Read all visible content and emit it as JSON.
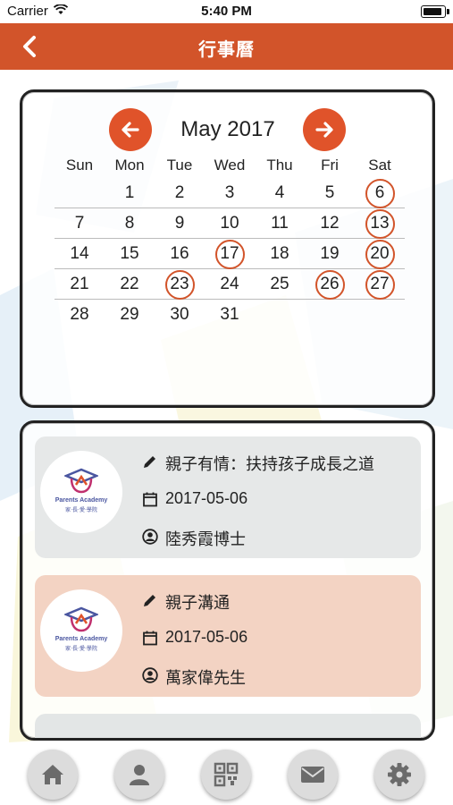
{
  "status_bar": {
    "carrier": "Carrier",
    "time": "5:40 PM"
  },
  "nav": {
    "title": "行事曆",
    "back_icon": "chevron-left-icon"
  },
  "calendar": {
    "month_label": "May 2017",
    "prev_icon": "arrow-left-icon",
    "next_icon": "arrow-right-icon",
    "weekdays": [
      "Sun",
      "Mon",
      "Tue",
      "Wed",
      "Thu",
      "Fri",
      "Sat"
    ],
    "weeks": [
      [
        "",
        "1",
        "2",
        "3",
        "4",
        "5",
        "6"
      ],
      [
        "7",
        "8",
        "9",
        "10",
        "11",
        "12",
        "13"
      ],
      [
        "14",
        "15",
        "16",
        "17",
        "18",
        "19",
        "20"
      ],
      [
        "21",
        "22",
        "23",
        "24",
        "25",
        "26",
        "27"
      ],
      [
        "28",
        "29",
        "30",
        "31",
        "",
        "",
        ""
      ]
    ],
    "marked_days": [
      "6",
      "13",
      "17",
      "20",
      "23",
      "26",
      "27"
    ],
    "accent_color": "#d2542a"
  },
  "events": [
    {
      "title": "親子有情：扶持孩子成長之道",
      "date": "2017-05-06",
      "speaker": "陸秀霞博士",
      "logo_en": "Parents Academy",
      "logo_zh": "家‧長‧愛‧學院",
      "card_color": "#e6e8e8"
    },
    {
      "title": "親子溝通",
      "date": "2017-05-06",
      "speaker": "萬家偉先生",
      "logo_en": "Parents Academy",
      "logo_zh": "家‧長‧愛‧學院",
      "card_color": "#f3d3c3"
    }
  ],
  "tab_bar": {
    "items": [
      {
        "name": "home",
        "icon": "home-icon"
      },
      {
        "name": "profile",
        "icon": "user-icon"
      },
      {
        "name": "qr",
        "icon": "qr-code-icon"
      },
      {
        "name": "messages",
        "icon": "mail-icon"
      },
      {
        "name": "settings",
        "icon": "gear-icon"
      }
    ]
  },
  "colors": {
    "header": "#d2542a",
    "tab_icon": "#6b6b6b"
  }
}
